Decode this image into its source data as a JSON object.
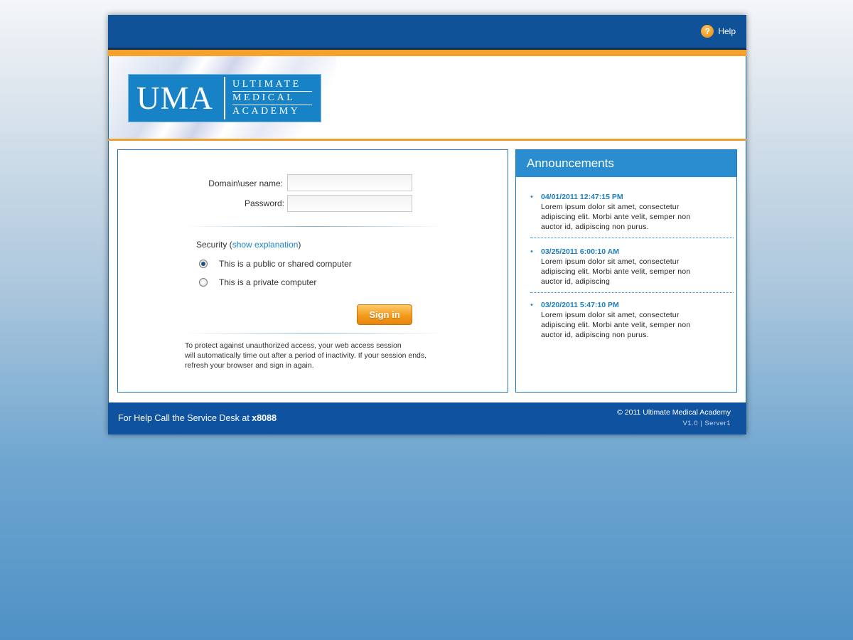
{
  "header": {
    "help_label": "Help",
    "help_icon": "question-icon",
    "help_icon_glyph": "?"
  },
  "logo": {
    "short": "UMA",
    "line1": "ULTIMATE",
    "line2": "MEDICAL",
    "line3": "ACADEMY"
  },
  "login": {
    "username_label": "Domain\\user name:",
    "username_value": "",
    "password_label": "Password:",
    "password_value": "",
    "security_prefix": "Security (",
    "security_link": "show explanation",
    "security_suffix": ")",
    "radio_options": [
      {
        "label": "This is a public or shared computer",
        "selected": true
      },
      {
        "label": "This is a private computer",
        "selected": false
      }
    ],
    "signin_label": "Sign in",
    "note_lines": [
      "To protect against unauthorized access, your web access session",
      "will automatically time out after a period of inactivity. If your session ends,",
      "refresh your browser and sign in again."
    ]
  },
  "announcements": {
    "title": "Announcements",
    "items": [
      {
        "date": "04/01/2011 12:47:15 PM",
        "body": "Lorem ipsum dolor sit amet, consectetur adipiscing elit. Morbi ante velit, semper non auctor id, adipiscing non purus."
      },
      {
        "date": "03/25/2011 6:00:10 AM",
        "body": "Lorem ipsum dolor sit amet, consectetur adipiscing elit. Morbi ante velit, semper non auctor id, adipiscing"
      },
      {
        "date": "03/20/2011 5:47:10 PM",
        "body": "Lorem ipsum dolor sit amet, consectetur adipiscing elit. Morbi ante velit, semper non auctor id, adipiscing non purus."
      }
    ]
  },
  "footer": {
    "help_text": "For Help Call the Service Desk at ",
    "help_ext": "x8088",
    "copyright": "© 2011 Ultimate Medical Academy",
    "version": "V1.0 | Server1"
  },
  "colors": {
    "brand_blue": "#0f5298",
    "accent_orange": "#f5a12c",
    "link_blue": "#1a84c6"
  }
}
